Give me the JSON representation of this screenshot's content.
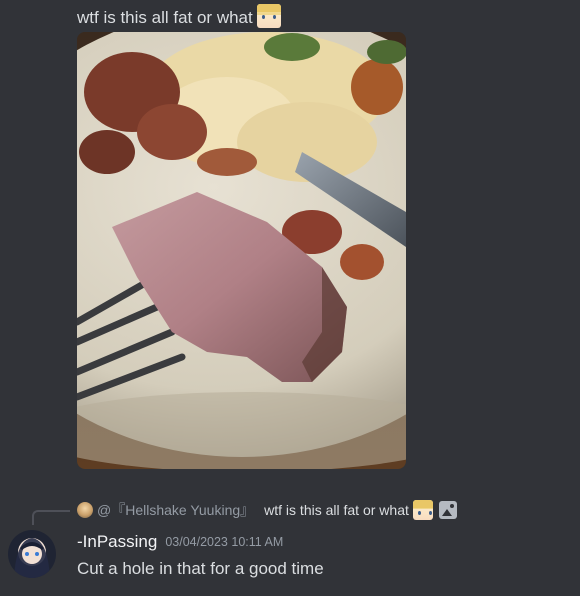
{
  "messages": {
    "previous": {
      "text": "wtf is this all fat or what",
      "emoji_icon": "anime-face-emoji"
    },
    "current": {
      "reply": {
        "mention": "@『Hellshake Yuuking』",
        "text": "wtf is this all fat or what",
        "attachment_icon": "image-icon"
      },
      "author": "-InPassing",
      "timestamp": "03/04/2023 10:11 AM",
      "content": "Cut a hole in that for a good time"
    }
  },
  "colors": {
    "background": "#313338",
    "text": "#dbdee1",
    "muted": "#949ba4",
    "author": "#f2f3f5"
  }
}
